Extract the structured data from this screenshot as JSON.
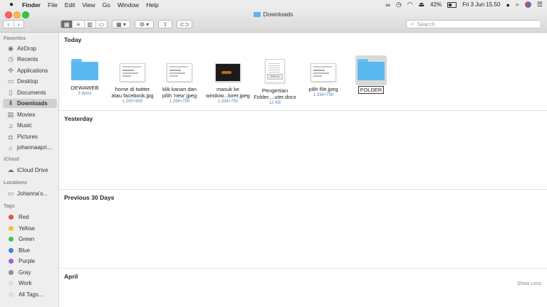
{
  "menubar": {
    "app": "Finder",
    "items": [
      "File",
      "Edit",
      "View",
      "Go",
      "Window",
      "Help"
    ],
    "battery": "42%",
    "clock": "Fri 3 Jun  15.50"
  },
  "window": {
    "title": "Downloads"
  },
  "toolbar": {
    "search_placeholder": "Search"
  },
  "sidebar": {
    "favorites_label": "Favorites",
    "favorites": [
      {
        "label": "AirDrop",
        "icon": "airdrop-icon"
      },
      {
        "label": "Recents",
        "icon": "clock-icon"
      },
      {
        "label": "Applications",
        "icon": "applications-icon"
      },
      {
        "label": "Desktop",
        "icon": "desktop-icon"
      },
      {
        "label": "Documents",
        "icon": "document-icon"
      },
      {
        "label": "Downloads",
        "icon": "download-icon"
      },
      {
        "label": "Movies",
        "icon": "film-icon"
      },
      {
        "label": "Music",
        "icon": "music-icon"
      },
      {
        "label": "Pictures",
        "icon": "camera-icon"
      },
      {
        "label": "johannaapri...",
        "icon": "home-icon"
      }
    ],
    "icloud_label": "iCloud",
    "icloud": [
      {
        "label": "iCloud Drive",
        "icon": "cloud-icon"
      }
    ],
    "locations_label": "Locations",
    "locations": [
      {
        "label": "Johanna's...",
        "icon": "laptop-icon"
      }
    ],
    "tags_label": "Tags",
    "tags": [
      {
        "label": "Red",
        "color": "#e0524b"
      },
      {
        "label": "Yellow",
        "color": "#f3c333"
      },
      {
        "label": "Green",
        "color": "#4fbf53"
      },
      {
        "label": "Blue",
        "color": "#3b86dd"
      },
      {
        "label": "Purple",
        "color": "#a35fc8"
      },
      {
        "label": "Gray",
        "color": "#8e8e8e"
      },
      {
        "label": "Work",
        "color": "#dddddd"
      },
      {
        "label": "All Tags...",
        "color": "#dddddd"
      }
    ]
  },
  "sections": {
    "today": "Today",
    "yesterday": "Yesterday",
    "previous30": "Previous 30 Days",
    "april": "April",
    "show_less": "Show Less"
  },
  "files": [
    {
      "name1": "DEWAWEB",
      "name2": "",
      "meta": "3 items"
    },
    {
      "name1": "home di twitter",
      "name2": "atau facebook.jpg",
      "meta": "1.200×900"
    },
    {
      "name1": "klik kanan dan",
      "name2": "pilih 'new'.jpeg",
      "meta": "1.334×750"
    },
    {
      "name1": "masuk ke",
      "name2": "window...lorer.jpeg",
      "meta": "1.334×750"
    },
    {
      "name1": "Pengertian",
      "name2": "Folder,...uter.docx",
      "meta": "12 KB"
    },
    {
      "name1": "pilih file.jpeg",
      "name2": "",
      "meta": "1.334×750"
    },
    {
      "name1": "FOLDER",
      "name2": "",
      "meta": ""
    }
  ],
  "doc_badge": "DOCX"
}
